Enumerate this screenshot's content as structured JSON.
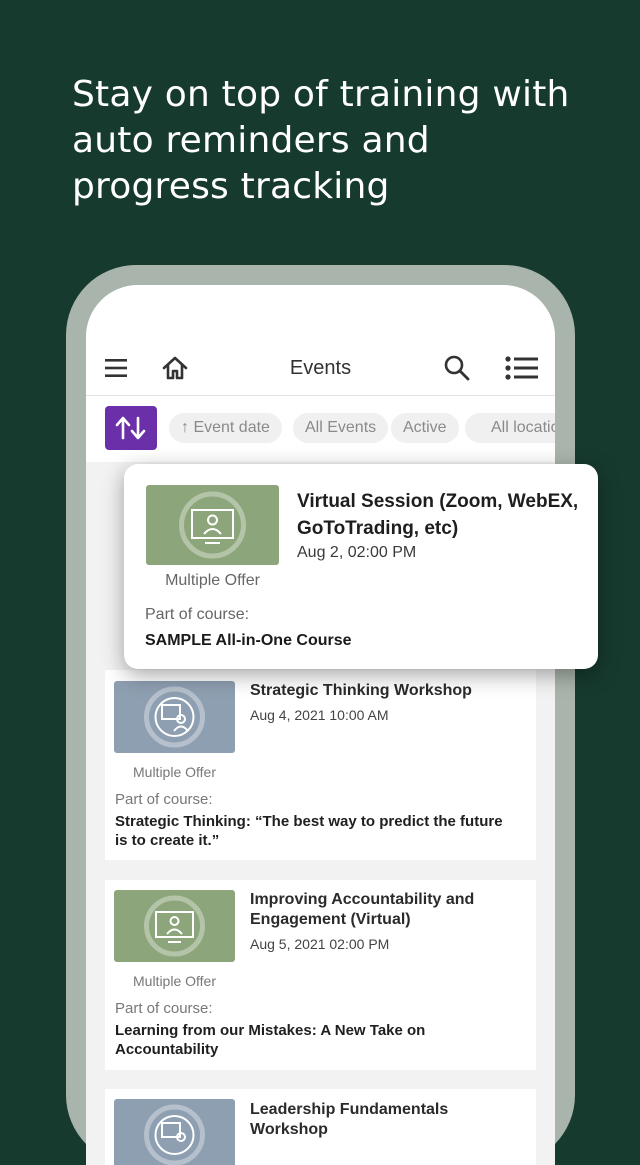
{
  "promo": {
    "headline_lines": [
      "Stay on top of training with",
      "auto reminders and",
      "progress tracking"
    ]
  },
  "app": {
    "header": {
      "title": "Events",
      "menu_icon": "hamburger-menu-icon",
      "home_icon": "home-icon",
      "search_icon": "search-icon",
      "list_icon": "list-view-icon"
    },
    "filters": {
      "sort_icon": "sort-arrows-icon",
      "chips": [
        "↑ Event date",
        "All Events",
        "Active",
        "All locatio"
      ]
    },
    "highlight_event": {
      "title": "Virtual Session (Zoom, WebEX, GoToTrading, etc)",
      "date": "Aug 2, 02:00 PM",
      "offer": "Multiple Offer",
      "course_label": "Part of course:",
      "course": "SAMPLE All-in-One Course",
      "thumb_icon": "virtual-training-icon"
    },
    "events": [
      {
        "title": "Strategic Thinking Workshop",
        "date": "Aug 4, 2021 10:00 AM",
        "offer": "Multiple Offer",
        "course_label": "Part of course:",
        "course": "Strategic Thinking:  “The best way to predict the future is to create it.”",
        "thumb_icon": "classroom-trainer-icon"
      },
      {
        "title": "Improving Accountability and Engagement (Virtual)",
        "date": "Aug 5, 2021 02:00 PM",
        "offer": "Multiple Offer",
        "course_label": "Part of course:",
        "course": "Learning from our Mistakes:  A New Take on Accountability",
        "thumb_icon": "virtual-training-icon"
      },
      {
        "title": "Leadership Fundamentals Workshop",
        "thumb_icon": "classroom-trainer-icon"
      }
    ]
  },
  "colors": {
    "background": "#173a2e",
    "phone_frame": "#a9b5ac",
    "accent_purple": "#6b2fa9",
    "thumb_green": "#8da57b",
    "thumb_blue": "#8e9fb1"
  }
}
